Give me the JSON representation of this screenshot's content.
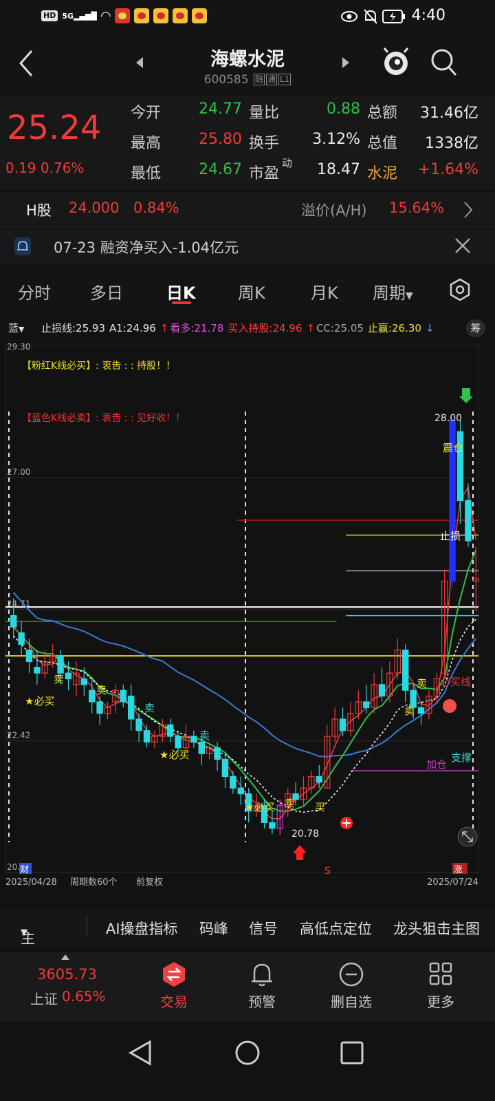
{
  "status": {
    "time": "4:40",
    "net": "HD",
    "sig": "5G"
  },
  "header": {
    "title": "海螺水泥",
    "code": "600585",
    "tags": [
      "融",
      "通",
      "L1"
    ]
  },
  "quote": {
    "price": "25.24",
    "change": "0.19",
    "change_pct": "0.76%",
    "rows": [
      [
        {
          "label": "今开",
          "value": "24.77",
          "color": "green"
        },
        {
          "label": "量比",
          "value": "0.88",
          "color": "green"
        },
        {
          "label": "总额",
          "value": "31.46亿",
          "color": "white"
        }
      ],
      [
        {
          "label": "最高",
          "value": "25.80",
          "color": "red"
        },
        {
          "label": "换手",
          "value": "3.12%",
          "color": "white"
        },
        {
          "label": "总值",
          "value": "1338亿",
          "color": "white"
        }
      ],
      [
        {
          "label": "最低",
          "value": "24.67",
          "color": "green"
        },
        {
          "label": "市盈",
          "label_sup": "动",
          "value": "18.47",
          "color": "white"
        },
        {
          "label": "水泥",
          "value": "+1.64%",
          "color": "red"
        }
      ]
    ]
  },
  "hshare": {
    "label": "H股",
    "price": "24.000",
    "pct": "0.84%",
    "premium_label": "溢价(A/H)",
    "premium": "15.64%"
  },
  "notice": {
    "text": "07-23 融资净买入-1.04亿元"
  },
  "tabs": [
    "分时",
    "多日",
    "日K",
    "周K",
    "月K",
    "周期"
  ],
  "active_tab": 2,
  "indicator": {
    "theme": "蓝",
    "items": [
      {
        "text": "止损线:25.93",
        "color": "#e8e8e8"
      },
      {
        "text": "A1:24.96",
        "color": "#e8e8e8"
      },
      {
        "text": "↑",
        "color": "#ff3030"
      },
      {
        "text": "看多:21.78",
        "color": "#e050e0"
      },
      {
        "text": "买入持股:24.96",
        "color": "#ff3a3a"
      },
      {
        "text": "↑",
        "color": "#ff3030"
      },
      {
        "text": "CC:25.05",
        "color": "#a8a8a8"
      },
      {
        "text": "止赢:26.30",
        "color": "#f0e040"
      },
      {
        "text": "↓",
        "color": "#40b0ff"
      }
    ],
    "button": "筹"
  },
  "chart_data": {
    "type": "candlestick",
    "y_labels": [
      "29.30",
      "27.00",
      "24.71",
      "22.42",
      "20."
    ],
    "ylim": [
      20.13,
      29.3
    ],
    "date_start": "2025/04/28",
    "date_end": "2025/07/24",
    "period_count": "周期数60个",
    "adjust": "前复权",
    "annotation_pink": "【粉红K线必买】: 衷告 : : 持股！！",
    "annotation_blue": "【蓝色K线必卖】: 衷告 : : 见好收！！",
    "low_label": "20.78",
    "high_label": "28.00",
    "labels": {
      "sell": "卖",
      "must_buy": "★必买",
      "buy": "买",
      "zhen_cang": "震仓",
      "stop_loss": "止损",
      "jia_cang": "加仓",
      "must_buy_line": "必买线",
      "support": "支撑",
      "cai": "财",
      "zhang": "涨",
      "s": "S"
    },
    "candles": [
      [
        24.6,
        24.4,
        24.9,
        24.2
      ],
      [
        24.3,
        24.1,
        24.5,
        23.9
      ],
      [
        24.0,
        23.8,
        24.2,
        23.6
      ],
      [
        23.7,
        23.6,
        24.0,
        23.4
      ],
      [
        23.6,
        23.8,
        24.0,
        23.5
      ],
      [
        23.8,
        23.9,
        24.1,
        23.7
      ],
      [
        23.9,
        23.6,
        24.0,
        23.4
      ],
      [
        23.6,
        23.5,
        23.8,
        23.3
      ],
      [
        23.4,
        23.6,
        23.8,
        23.2
      ],
      [
        23.5,
        23.4,
        23.7,
        23.2
      ],
      [
        23.3,
        23.1,
        23.5,
        22.9
      ],
      [
        23.1,
        22.9,
        23.2,
        22.7
      ],
      [
        22.9,
        23.0,
        23.1,
        22.8
      ],
      [
        23.1,
        23.3,
        23.4,
        22.9
      ],
      [
        23.3,
        23.1,
        23.4,
        23.0
      ],
      [
        23.2,
        22.8,
        23.4,
        22.6
      ],
      [
        22.8,
        22.6,
        22.9,
        22.4
      ],
      [
        22.6,
        22.4,
        22.7,
        22.3
      ],
      [
        22.4,
        22.5,
        22.6,
        22.3
      ],
      [
        22.5,
        22.7,
        22.8,
        22.4
      ],
      [
        22.7,
        22.5,
        22.8,
        22.4
      ],
      [
        22.5,
        22.3,
        22.6,
        22.2
      ],
      [
        22.3,
        22.5,
        22.7,
        22.2
      ],
      [
        22.5,
        22.4,
        22.6,
        22.3
      ],
      [
        22.4,
        22.2,
        22.5,
        22.0
      ],
      [
        22.2,
        22.3,
        22.4,
        22.1
      ],
      [
        22.3,
        22.1,
        22.4,
        21.9
      ],
      [
        22.1,
        21.8,
        22.2,
        21.6
      ],
      [
        21.8,
        21.6,
        21.9,
        21.5
      ],
      [
        21.6,
        21.5,
        21.8,
        21.3
      ],
      [
        21.5,
        21.2,
        21.6,
        21.0
      ],
      [
        21.2,
        21.3,
        21.5,
        21.1
      ],
      [
        21.3,
        21.0,
        21.4,
        20.9
      ],
      [
        21.0,
        20.9,
        21.2,
        20.8
      ],
      [
        20.9,
        21.3,
        21.4,
        20.78
      ],
      [
        21.2,
        21.5,
        21.6,
        21.1
      ],
      [
        21.5,
        21.4,
        21.7,
        21.3
      ],
      [
        21.4,
        21.6,
        21.8,
        21.3
      ],
      [
        21.6,
        21.8,
        21.9,
        21.5
      ],
      [
        21.8,
        21.7,
        22.0,
        21.6
      ],
      [
        21.6,
        22.5,
        22.7,
        21.6
      ],
      [
        22.5,
        22.8,
        23.0,
        22.4
      ],
      [
        22.8,
        22.6,
        23.0,
        22.5
      ],
      [
        22.6,
        22.9,
        23.1,
        22.5
      ],
      [
        22.9,
        23.1,
        23.3,
        22.8
      ],
      [
        23.1,
        23.0,
        23.4,
        22.9
      ],
      [
        23.0,
        23.4,
        23.6,
        22.9
      ],
      [
        23.4,
        23.2,
        23.7,
        23.1
      ],
      [
        23.2,
        23.6,
        23.8,
        23.1
      ],
      [
        23.6,
        24.0,
        24.2,
        23.5
      ],
      [
        24.0,
        23.3,
        24.1,
        23.1
      ],
      [
        23.3,
        23.0,
        23.4,
        22.8
      ],
      [
        23.0,
        22.9,
        23.1,
        22.7
      ],
      [
        22.9,
        23.2,
        23.3,
        22.8
      ],
      [
        23.2,
        23.5,
        23.6,
        23.1
      ],
      [
        23.6,
        25.2,
        25.4,
        23.5
      ],
      [
        25.2,
        28.0,
        28.0,
        25.1
      ],
      [
        27.8,
        26.6,
        28.0,
        26.2
      ],
      [
        26.6,
        25.9,
        26.9,
        25.8
      ],
      [
        25.2,
        25.24,
        25.8,
        24.67
      ]
    ],
    "hlines": [
      {
        "y": 26.26,
        "color": "#b02020",
        "from": 0.49
      },
      {
        "y": 26.0,
        "color": "#f0e020",
        "from": 0.72
      },
      {
        "y": 25.38,
        "color": "#a0a0a0",
        "from": 0.72
      },
      {
        "y": 24.75,
        "color": "#ffffff",
        "from": 0.0,
        "w": 2
      },
      {
        "y": 24.6,
        "color": "#3ad0d0",
        "from": 0.72
      },
      {
        "y": 24.5,
        "color": "#1a9a2a",
        "from": 0.0,
        "to": 0.7
      },
      {
        "y": 23.9,
        "color": "#f0d020",
        "from": 0.0,
        "w": 2
      },
      {
        "y": 21.9,
        "color": "#c040c0",
        "from": 0.73
      }
    ]
  },
  "toolbar": [
    "主图",
    "AI操盘指标",
    "码峰",
    "信号",
    "高低点定位",
    "龙头狙击主图"
  ],
  "bottom_nav": {
    "index_value": "3605.73",
    "index_name": "上证",
    "index_pct": "0.65%",
    "items": [
      "交易",
      "预警",
      "删自选",
      "更多"
    ]
  }
}
